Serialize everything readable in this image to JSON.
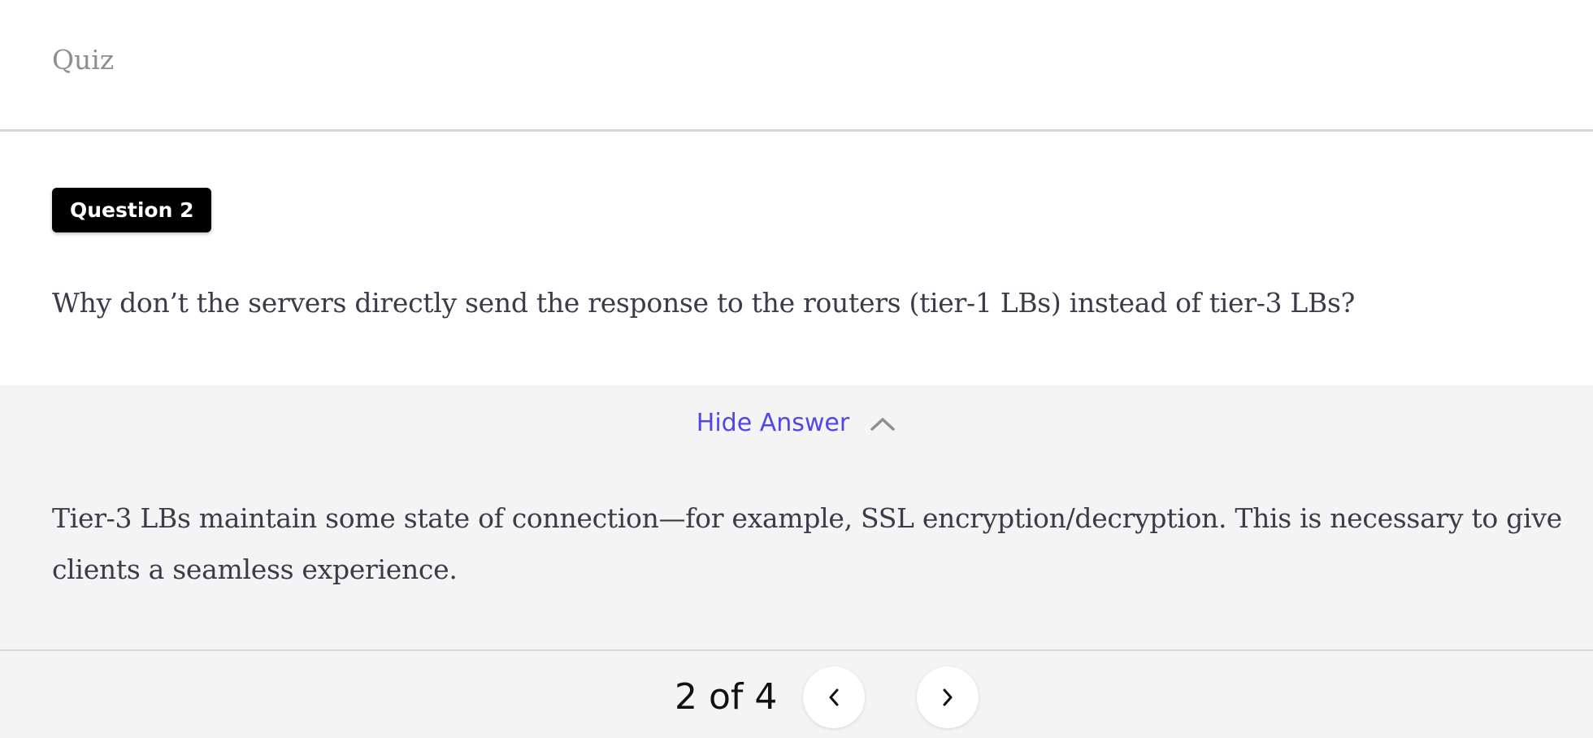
{
  "header": {
    "title": "Quiz"
  },
  "question": {
    "badge": "Question 2",
    "text": "Why don’t the servers directly send the response to the routers (tier-1 LBs) instead of tier-3 LBs?"
  },
  "answer": {
    "toggle_label": "Hide Answer",
    "toggle_icon": "chevron-up-icon",
    "text": "Tier-3 LBs maintain some state of connection—for example, SSL encryption/decryption. This is necessary to give clients a seamless experience."
  },
  "pagination": {
    "indicator": "2 of 4",
    "prev_icon": "chevron-left-icon",
    "next_icon": "chevron-right-icon"
  },
  "colors": {
    "accent": "#5047e5",
    "badge_bg": "#000000",
    "answer_bg": "#f4f4f4",
    "body_text": "#3b3b4a",
    "muted_text": "#8e8e94"
  }
}
